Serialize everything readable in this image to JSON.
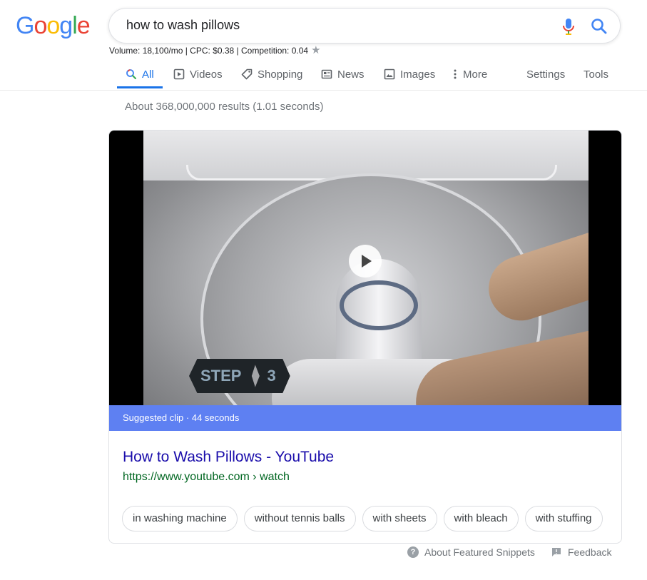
{
  "logo": {
    "text": "Google"
  },
  "search": {
    "query": "how to wash pillows"
  },
  "keyword_stats": {
    "text": "Volume: 18,100/mo | CPC: $0.38 | Competition: 0.04"
  },
  "tabs": [
    {
      "label": "All",
      "icon": "search-icon",
      "active": true
    },
    {
      "label": "Videos",
      "icon": "video-icon"
    },
    {
      "label": "Shopping",
      "icon": "tag-icon"
    },
    {
      "label": "News",
      "icon": "news-icon"
    },
    {
      "label": "Images",
      "icon": "image-icon"
    },
    {
      "label": "More",
      "icon": "more-vert-icon"
    }
  ],
  "tools": {
    "settings": "Settings",
    "tools": "Tools"
  },
  "results_stats": "About 368,000,000 results (1.01 seconds)",
  "featured": {
    "video_step_word": "STEP",
    "video_step_number": "3",
    "clip_label": "Suggested clip · 44 seconds",
    "title": "How to Wash Pillows - YouTube",
    "url": "https://www.youtube.com › watch",
    "chips": [
      "in washing machine",
      "without tennis balls",
      "with sheets",
      "with bleach",
      "with stuffing"
    ]
  },
  "footer": {
    "about": "About Featured Snippets",
    "feedback": "Feedback"
  },
  "colors": {
    "accent": "#1a73e8",
    "link": "#1a0dab",
    "url": "#006621",
    "clipbar": "#5e80f2"
  }
}
